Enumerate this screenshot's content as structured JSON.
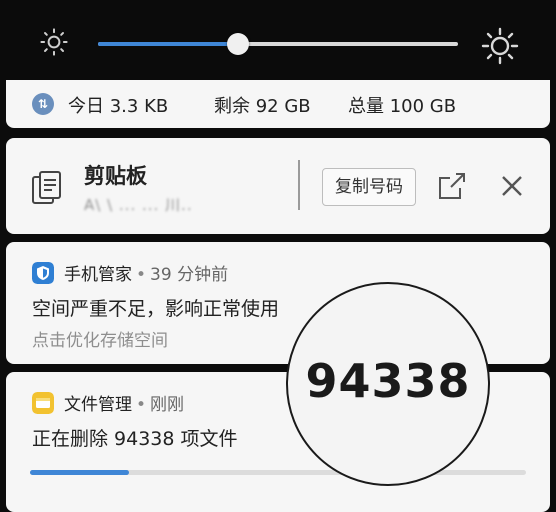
{
  "brightness": {
    "level": 0.39,
    "low_icon": "sun-dim-icon",
    "high_icon": "sun-bright-icon",
    "accent": "#3f86d6"
  },
  "data_usage": {
    "icon": "arrows-updown-icon",
    "today": "今日 3.3 KB",
    "remaining": "剩余 92 GB",
    "total": "总量 100 GB"
  },
  "clipboard": {
    "icon": "clipboard-icon",
    "title": "剪贴板",
    "content": "A\\ \\ ... ... 川..",
    "copy_button": "复制号码",
    "share_icon": "share-icon",
    "close_icon": "close-icon"
  },
  "notifications": [
    {
      "app": "手机管家",
      "separator": "•",
      "time": "39 分钟前",
      "title": "空间严重不足，影响正常使用",
      "subtitle": "点击优化存储空间",
      "icon": "shield-icon",
      "icon_color": "#2f7fd3"
    },
    {
      "app": "文件管理",
      "separator": "•",
      "time": "刚刚",
      "title": "正在删除 94338 项文件",
      "icon": "folder-icon",
      "icon_color": "#f2c230",
      "progress": 0.2
    }
  ],
  "magnifier": {
    "text": "94338"
  }
}
